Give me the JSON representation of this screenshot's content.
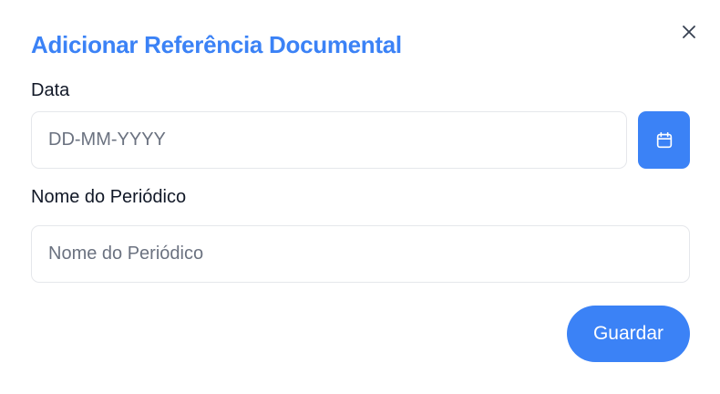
{
  "dialog": {
    "title": "Adicionar Referência Documental",
    "close_icon": "close-icon"
  },
  "fields": {
    "date": {
      "label": "Data",
      "value": "",
      "placeholder": "DD-MM-YYYY",
      "button_icon": "calendar-icon"
    },
    "journal": {
      "label": "Nome do Periódico",
      "value": "",
      "placeholder": "Nome do Periódico"
    }
  },
  "actions": {
    "save_label": "Guardar"
  },
  "colors": {
    "accent": "#3b82f6",
    "text": "#111827",
    "placeholder": "#6b7280",
    "border": "#e5e7eb"
  }
}
